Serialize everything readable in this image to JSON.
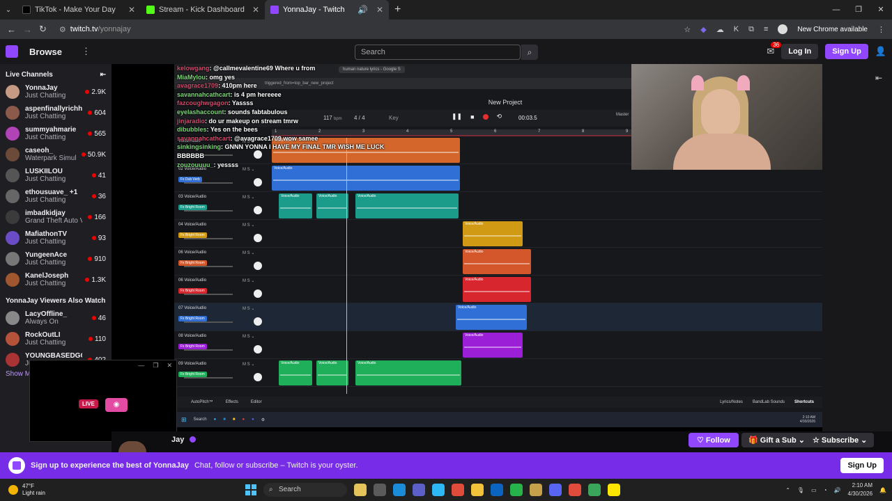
{
  "browser": {
    "tabs": [
      {
        "title": "TikTok - Make Your Day",
        "color": "#000000"
      },
      {
        "title": "Stream - Kick Dashboard",
        "color": "#53fc18"
      },
      {
        "title": "YonnaJay - Twitch",
        "color": "#9146ff"
      }
    ],
    "new_tab": "+",
    "url_host": "twitch.tv",
    "url_path": "/yonnajay",
    "new_chrome": "New Chrome available"
  },
  "twitch": {
    "browse": "Browse",
    "search_placeholder": "Search",
    "notif_count": "36",
    "login": "Log In",
    "signup": "Sign Up"
  },
  "sidebar": {
    "heading": "Live Channels",
    "channels": [
      {
        "name": "YonnaJay",
        "game": "Just Chatting",
        "viewers": "2.9K",
        "color": "#c79b83"
      },
      {
        "name": "aspenfinallyrichh",
        "game": "Just Chatting",
        "viewers": "604",
        "color": "#8b5a4a"
      },
      {
        "name": "summyahmarie",
        "game": "Just Chatting",
        "viewers": "565",
        "color": "#b043b5"
      },
      {
        "name": "caseoh_",
        "game": "Waterpark Simul...",
        "viewers": "50.9K",
        "color": "#6b4a3a"
      },
      {
        "name": "LUSKIILOU",
        "game": "Just Chatting",
        "viewers": "41",
        "color": "#555"
      },
      {
        "name": "ethousuave_ +1",
        "game": "Just Chatting",
        "viewers": "36",
        "color": "#666"
      },
      {
        "name": "imbadkidjay",
        "game": "Grand Theft Auto V",
        "viewers": "166",
        "color": "#3b3b3b"
      },
      {
        "name": "MafiathonTV",
        "game": "Just Chatting",
        "viewers": "93",
        "color": "#6a4cc7"
      },
      {
        "name": "YungeenAce",
        "game": "Just Chatting",
        "viewers": "910",
        "color": "#777"
      },
      {
        "name": "KanelJoseph",
        "game": "Just Chatting",
        "viewers": "1.3K",
        "color": "#a0572f"
      }
    ],
    "also_watch_heading": "YonnaJay Viewers Also Watch",
    "also_watch": [
      {
        "name": "LacyOffline_",
        "game": "Always On",
        "viewers": "46",
        "color": "#888"
      },
      {
        "name": "RockOutLI",
        "game": "Just Chatting",
        "viewers": "110",
        "color": "#b4533a"
      },
      {
        "name": "YOUNGBASEDGO",
        "game": "Ju...",
        "viewers": "402",
        "color": "#a33"
      }
    ],
    "show_more": "Show M"
  },
  "daw": {
    "inner_tab": "human nature lyrics - Google S",
    "inner_url": "triggered_from=top_bar_new_project",
    "title": "New Project",
    "bpm": "117",
    "bpm_unit": "bpm",
    "signature": "4 / 4",
    "key": "Key",
    "time": "00:03.5",
    "master": "Master",
    "ruler": [
      "1",
      "2",
      "3",
      "4",
      "5",
      "6",
      "7",
      "8",
      "9"
    ],
    "tracks": [
      {
        "name": "Voice/Audio",
        "fx": "",
        "fx_color": "#d4662b"
      },
      {
        "name": "02 Voice/Audio",
        "fx": "Fx Dub Verb",
        "fx_color": "#2f6fd6"
      },
      {
        "name": "03 Voice/Audio",
        "fx": "Fx Bright Room",
        "fx_color": "#1b9c8a"
      },
      {
        "name": "04 Voice/Audio",
        "fx": "Fx Bright Room",
        "fx_color": "#d09a15"
      },
      {
        "name": "06 Voice/Audio",
        "fx": "Fx Bright Room",
        "fx_color": "#d4572b"
      },
      {
        "name": "06 Voice/Audio",
        "fx": "Fx Bright Room",
        "fx_color": "#d8262e"
      },
      {
        "name": "07 Voice/Audio",
        "fx": "Fx Bright Room",
        "fx_color": "#2f6fd6"
      },
      {
        "name": "08 Voice/Audio",
        "fx": "Fx Bright Room",
        "fx_color": "#9a1fd6"
      },
      {
        "name": "09 Voice/Audio",
        "fx": "Fx Bright Room",
        "fx_color": "#1fae5a"
      }
    ],
    "clip_label": "Voice/Audio",
    "bottom_left": [
      "AutoPitch™",
      "Effects",
      "Editor"
    ],
    "bottom_right": [
      "Lyrics/Notes",
      "BandLab Sounds",
      "Shortcuts"
    ],
    "taskbar_search": "Search",
    "taskbar_time": "2:10 AM",
    "taskbar_date": "4/30/2026"
  },
  "chat": [
    {
      "user": "kelowgang",
      "text": ": @callmevalentine69 Where u from"
    },
    {
      "user": "MiaMylou",
      "text": ": omg yes"
    },
    {
      "user": "avagrace1709",
      "text": ": 410pm here"
    },
    {
      "user": "savannahcathcart",
      "text": ": is 4 pm hereeee"
    },
    {
      "user": "fazcoughwgagon",
      "text": ": Yassss"
    },
    {
      "user": "eyelashaccount",
      "text": ": sounds fabtabulous"
    },
    {
      "user": "jinjaradio",
      "text": ": do ur makeup on stream tmrw"
    },
    {
      "user": "dibubbles",
      "text": ": Yes on the bees"
    },
    {
      "user": "savannahcathcart",
      "text": ": @avagrace1709 wow samee"
    },
    {
      "user": "sinkingsinking",
      "text": ": GNNN YONNA I HAVE MY FINAL TMR WISH ME LUCK"
    },
    {
      "user": "",
      "text": "BBBBBB"
    },
    {
      "user": "zouzouuuu_",
      "text": ": yessss"
    }
  ],
  "stream": {
    "streamer": "Jay",
    "follow": "Follow",
    "gift": "Gift a Sub",
    "subscribe": "Subscribe"
  },
  "promo": {
    "bold": "Sign up to experience the best of YonnaJay",
    "text": "Chat, follow or subscribe – Twitch is your oyster.",
    "signup": "Sign Up"
  },
  "mini_player": {
    "live": "LIVE"
  },
  "taskbar": {
    "temp": "47°F",
    "weather": "Light rain",
    "search": "Search",
    "time": "2:10 AM",
    "date": "4/30/2026",
    "apps": [
      "#e4c45a",
      "#5b5b5b",
      "#1a8cd8",
      "#5b5fc7",
      "#2db7f5",
      "#e14b3b",
      "#f2c23a",
      "#0b64c0",
      "#25b34a",
      "#c4a14a",
      "#5865f2",
      "#e14b3b",
      "#3aa45a",
      "#ffe600"
    ]
  }
}
